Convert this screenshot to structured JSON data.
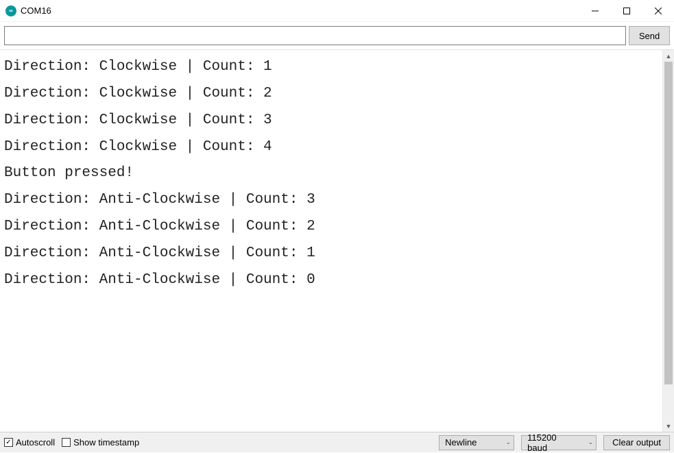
{
  "window": {
    "title": "COM16",
    "icon": "arduino-infinity-icon"
  },
  "input": {
    "value": "",
    "placeholder": ""
  },
  "buttons": {
    "send": "Send",
    "clear": "Clear output"
  },
  "console_lines": [
    "Direction: Clockwise | Count: 1",
    "Direction: Clockwise | Count: 2",
    "Direction: Clockwise | Count: 3",
    "Direction: Clockwise | Count: 4",
    "Button pressed!",
    "Direction: Anti-Clockwise | Count: 3",
    "Direction: Anti-Clockwise | Count: 2",
    "Direction: Anti-Clockwise | Count: 1",
    "Direction: Anti-Clockwise | Count: 0"
  ],
  "bottom": {
    "autoscroll": {
      "label": "Autoscroll",
      "checked": true
    },
    "show_timestamp": {
      "label": "Show timestamp",
      "checked": false
    },
    "line_ending": {
      "selected": "Newline"
    },
    "baud": {
      "selected": "115200 baud"
    }
  }
}
